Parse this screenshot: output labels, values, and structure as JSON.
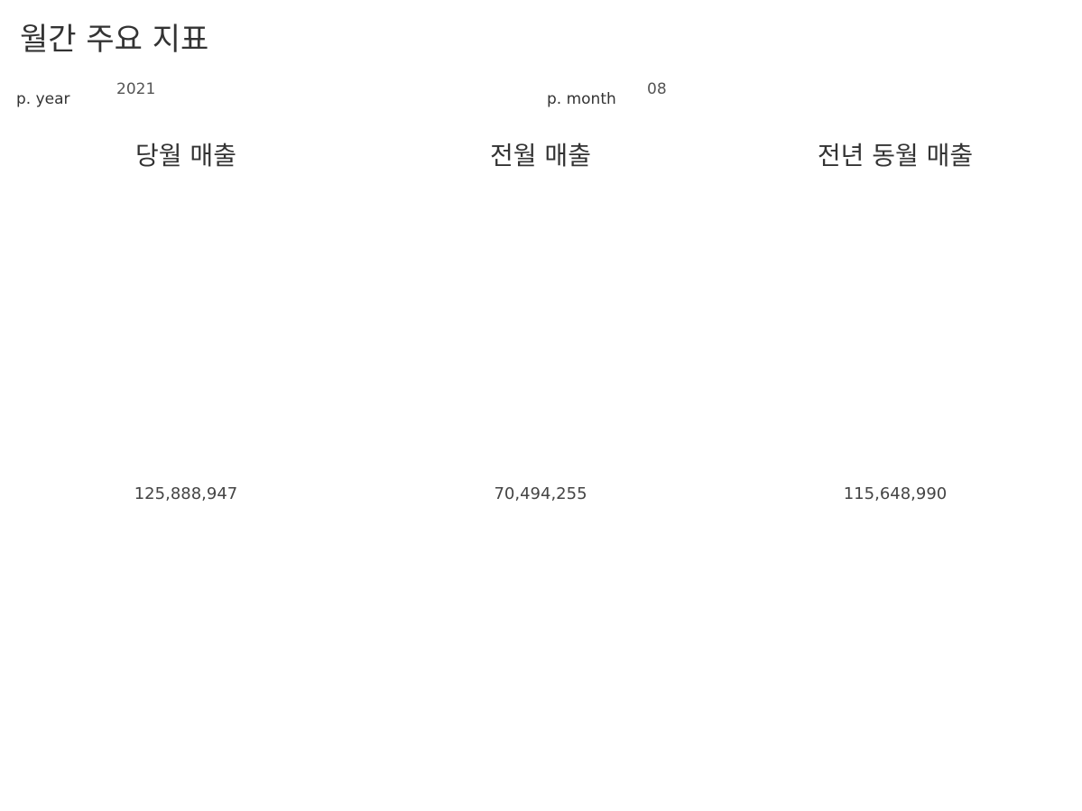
{
  "dashboard": {
    "title": "월간 주요 지표"
  },
  "parameters": {
    "year": {
      "label": "p. year",
      "value": "2021"
    },
    "month": {
      "label": "p. month",
      "value": "08"
    }
  },
  "kpis": [
    {
      "title": "당월 매출",
      "value": "125,888,947"
    },
    {
      "title": "전월 매출",
      "value": "70,494,255"
    },
    {
      "title": "전년 동월 매출",
      "value": "115,648,990"
    }
  ]
}
